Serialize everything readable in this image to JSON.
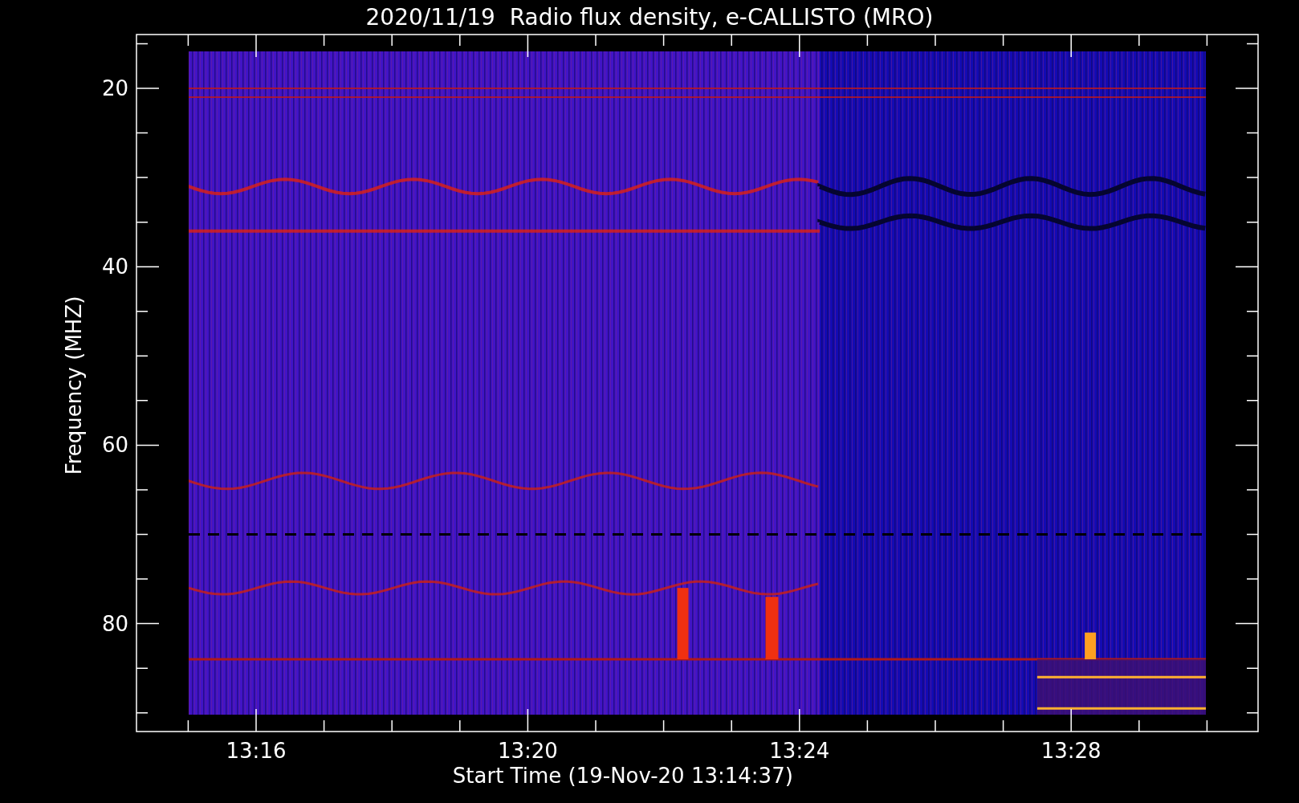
{
  "title": "2020/11/19  Radio flux density, e-CALLISTO (MRO)",
  "plot": {
    "xlabel": "Start Time (19-Nov-20 13:14:37)",
    "ylabel": "Frequency (MHZ)",
    "xticks": [
      "13:16",
      "13:20",
      "13:24",
      "13:28"
    ],
    "yticks": [
      "20",
      "40",
      "60",
      "80"
    ]
  }
}
